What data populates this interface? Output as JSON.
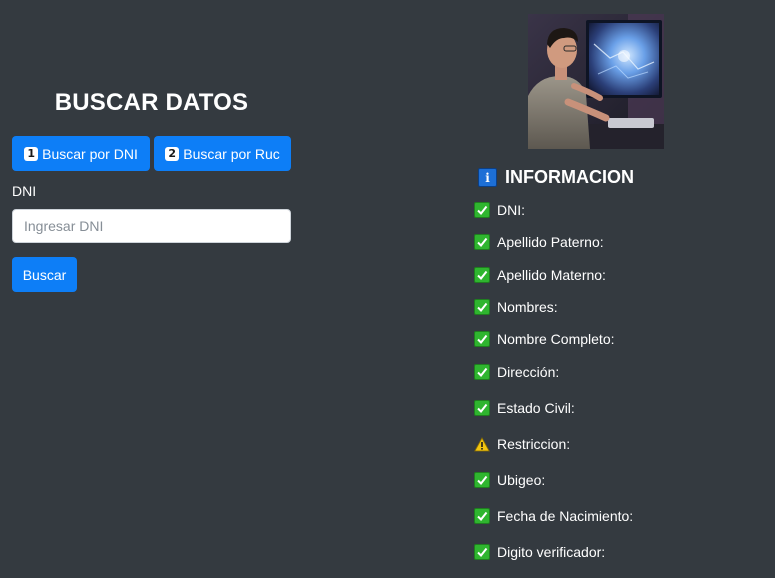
{
  "search_panel": {
    "title": "BUSCAR DATOS",
    "mode_buttons": [
      {
        "badge": "1",
        "label": "Buscar por DNI"
      },
      {
        "badge": "2",
        "label": "Buscar por Ruc"
      }
    ],
    "field_label": "DNI",
    "input": {
      "value": "",
      "placeholder": "Ingresar DNI"
    },
    "submit_label": "Buscar",
    "accent_color": "#0d7ef7"
  },
  "info_panel": {
    "icon": "information-icon",
    "title": "INFORMACION",
    "fields": [
      {
        "icon": "check-icon",
        "label": "DNI:",
        "value": ""
      },
      {
        "icon": "check-icon",
        "label": "Apellido Paterno:",
        "value": ""
      },
      {
        "icon": "check-icon",
        "label": "Apellido Materno:",
        "value": ""
      },
      {
        "icon": "check-icon",
        "label": "Nombres:",
        "value": ""
      },
      {
        "icon": "check-icon",
        "label": "Nombre Completo:",
        "value": ""
      },
      {
        "icon": "check-icon",
        "label": "Dirección:",
        "value": ""
      },
      {
        "icon": "check-icon",
        "label": "Estado Civil:",
        "value": ""
      },
      {
        "icon": "warning-icon",
        "label": "Restriccion:",
        "value": ""
      },
      {
        "icon": "check-icon",
        "label": "Ubigeo:",
        "value": ""
      },
      {
        "icon": "check-icon",
        "label": "Fecha de Nacimiento:",
        "value": ""
      },
      {
        "icon": "check-icon",
        "label": "Digito verificador:",
        "value": ""
      }
    ]
  },
  "colors": {
    "background": "#343a40",
    "primary_button": "#0d7ef7",
    "check_green": "#2fb52f",
    "info_blue": "#1d6fd6",
    "warning_yellow": "#f2c511"
  }
}
